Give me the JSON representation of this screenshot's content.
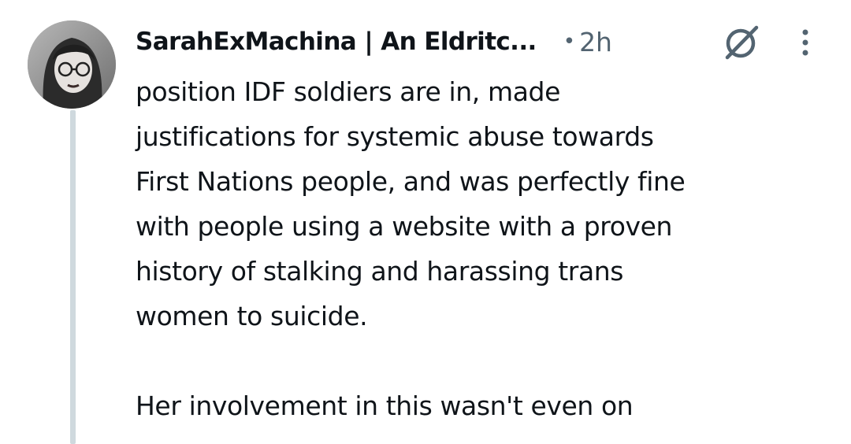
{
  "tweet": {
    "author": {
      "display_name": "SarahExMachina | An Eldritc...",
      "avatar_icon": "avatar-photo"
    },
    "separator": "•",
    "timestamp": "2h",
    "grok_icon": "slashed-circle-icon",
    "more_icon": "vertical-ellipsis-icon",
    "text_paragraph_1": "position IDF soldiers are in, made\njustifications for systemic abuse towards\nFirst Nations people, and was perfectly fine\nwith people using a website with a proven\nhistory of stalking and harassing trans\nwomen to suicide.",
    "text_paragraph_2": "Her involvement in this wasn't even on"
  },
  "colors": {
    "text_primary": "#0f1419",
    "text_secondary": "#536471",
    "thread_line": "#cfd9de"
  }
}
